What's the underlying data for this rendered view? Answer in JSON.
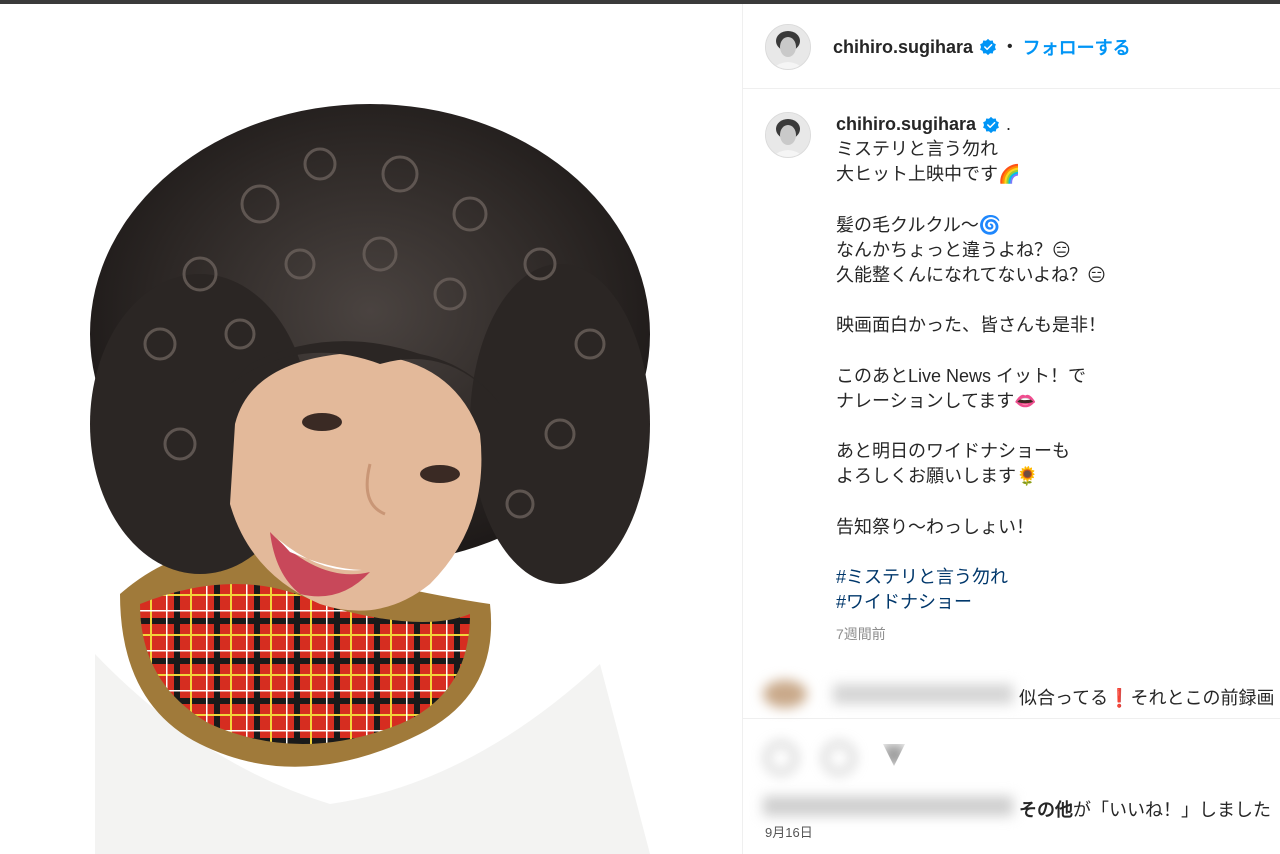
{
  "post": {
    "username": "chihiro.sugihara",
    "follow_label": "フォローする",
    "header_separator": "•",
    "caption_dot": ".",
    "caption_lines": [
      "ミステリと言う勿れ",
      "大ヒット上映中です🌈",
      "",
      "髪の毛クルクル〜🌀",
      "なんかちょっと違うよね？😑",
      "久能整くんになれてないよね？😑",
      "",
      "映画面白かった、皆さんも是非！",
      "",
      "このあとLive News イット！で",
      "ナレーションしてます👄",
      "",
      "あと明日のワイドナショーも",
      "よろしくお願いします🌻",
      "",
      "告知祭り〜わっしょい！",
      ""
    ],
    "hashtags": [
      "#ミステリと言う勿れ",
      "#ワイドナショー"
    ],
    "posted_ago": "7週間前",
    "comment_text": "似合ってる❗️それとこの前録画",
    "likes_bold": "その他",
    "likes_rest": "が「いいね！」しました",
    "date": "9月16日"
  },
  "icons": [
    "verified-badge-icon",
    "heart-icon",
    "comment-icon",
    "share-icon"
  ],
  "colors": {
    "accent": "#0095f6",
    "hashtag": "#00376b",
    "muted": "#8e8e8e"
  }
}
